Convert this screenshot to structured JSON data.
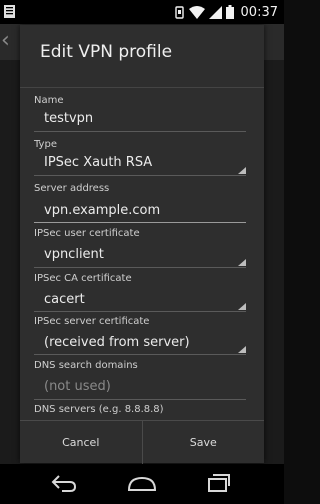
{
  "status_bar": {
    "time": "00:37",
    "icons": [
      "notification-icon",
      "alarm-icon",
      "wifi-icon",
      "signal-icon",
      "battery-icon"
    ]
  },
  "dialog": {
    "title": "Edit VPN profile",
    "fields": [
      {
        "label": "Name",
        "value": "testvpn",
        "kind": "text"
      },
      {
        "label": "Type",
        "value": "IPSec Xauth RSA",
        "kind": "spinner"
      },
      {
        "label": "Server address",
        "value": "vpn.example.com",
        "kind": "text"
      },
      {
        "label": "IPSec user certificate",
        "value": "vpnclient",
        "kind": "spinner"
      },
      {
        "label": "IPSec CA certificate",
        "value": "cacert",
        "kind": "spinner"
      },
      {
        "label": "IPSec server certificate",
        "value": "(received from server)",
        "kind": "spinner"
      },
      {
        "label": "DNS search domains",
        "placeholder": "(not used)",
        "kind": "text"
      },
      {
        "label": "DNS servers (e.g. 8.8.8.8)",
        "kind": "text"
      }
    ],
    "buttons": {
      "cancel": "Cancel",
      "save": "Save"
    }
  },
  "nav_bar": {
    "icons": [
      "back-icon",
      "home-icon",
      "recents-icon"
    ]
  },
  "colors": {
    "dialog_bg": "#2e2e2e",
    "status_bar": "#000000",
    "text": "#e6e6e6"
  }
}
